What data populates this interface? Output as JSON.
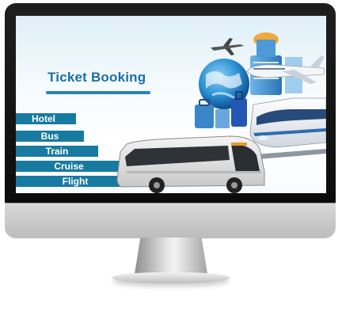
{
  "screen": {
    "headline": "Ticket Booking"
  },
  "menu": {
    "items": [
      {
        "label": "Hotel"
      },
      {
        "label": "Bus"
      },
      {
        "label": "Train"
      },
      {
        "label": "Cruise"
      },
      {
        "label": "Flight"
      }
    ]
  },
  "colors": {
    "accent": "#177aa1",
    "headline": "#1b6fa3",
    "bezel": "#111111",
    "chin": "#cccccc"
  },
  "icons": [
    "airplane-icon",
    "globe-icon",
    "luggage-icon",
    "building-icon",
    "jet-icon",
    "bullet-train-icon",
    "bus-icon"
  ]
}
